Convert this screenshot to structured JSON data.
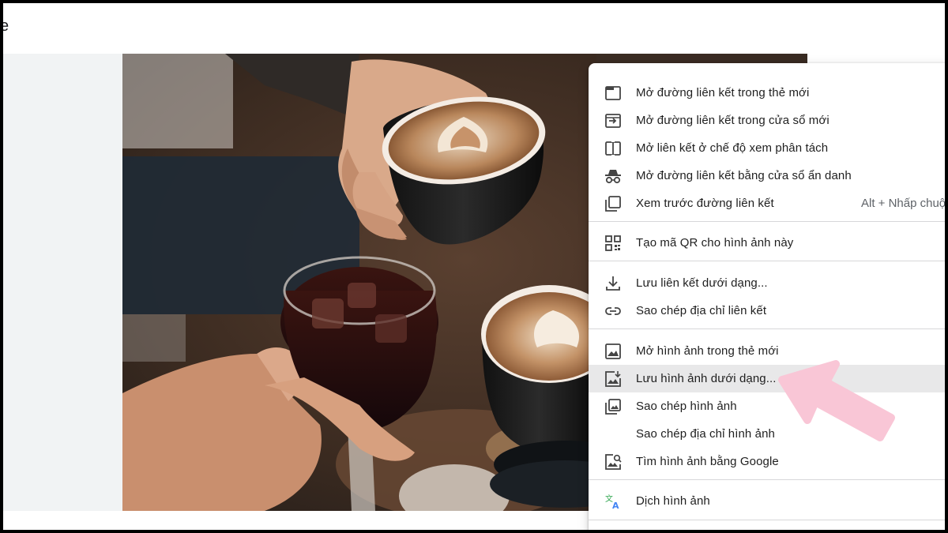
{
  "topbar": {
    "partial_title": "e"
  },
  "context_menu": {
    "items": [
      {
        "label": "Mở đường liên kết trong thẻ mới",
        "icon": "new-tab-icon"
      },
      {
        "label": "Mở đường liên kết trong cửa sổ mới",
        "icon": "new-window-icon"
      },
      {
        "label": "Mở liên kết ở chế độ xem phân tách",
        "icon": "split-view-icon"
      },
      {
        "label": "Mở đường liên kết bằng cửa sổ ẩn danh",
        "icon": "incognito-icon"
      },
      {
        "label": "Xem trước đường liên kết",
        "icon": "preview-link-icon",
        "shortcut": "Alt + Nhấp chuột"
      },
      {
        "label": "Tạo mã QR cho hình ảnh này",
        "icon": "qr-code-icon"
      },
      {
        "label": "Lưu liên kết dưới dạng...",
        "icon": "download-icon"
      },
      {
        "label": "Sao chép địa chỉ liên kết",
        "icon": "link-icon"
      },
      {
        "label": "Mở hình ảnh trong thẻ mới",
        "icon": "image-icon"
      },
      {
        "label": "Lưu hình ảnh dưới dạng...",
        "icon": "save-image-icon",
        "highlighted": true
      },
      {
        "label": "Sao chép hình ảnh",
        "icon": "copy-image-icon"
      },
      {
        "label": "Sao chép địa chỉ hình ảnh",
        "icon": ""
      },
      {
        "label": "Tìm hình ảnh bằng Google",
        "icon": "image-search-icon"
      },
      {
        "label": "Dịch hình ảnh",
        "icon": "translate-icon"
      }
    ]
  },
  "annotation": {
    "arrow_color": "#f9c6d6"
  },
  "colors": {
    "menu_highlight": "#e8e8e9",
    "left_panel": "#f1f3f4"
  }
}
